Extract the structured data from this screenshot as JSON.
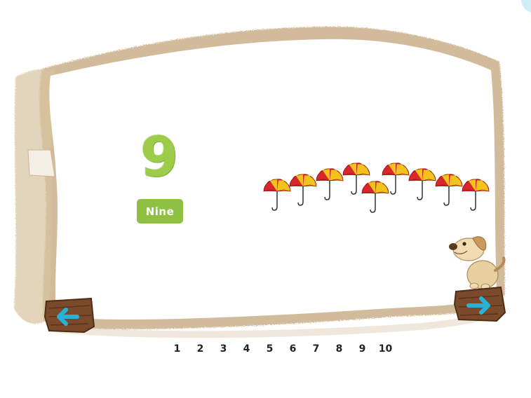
{
  "lesson": {
    "digit": "9",
    "word": "Nine",
    "object_count": 9,
    "object_icon": "umbrella-icon"
  },
  "number_nav": [
    "1",
    "2",
    "3",
    "4",
    "5",
    "6",
    "7",
    "8",
    "9",
    "10"
  ],
  "colors": {
    "digit": "#9ccc4a",
    "badge": "#8fc043",
    "umbrella_red": "#d8262a",
    "umbrella_yellow": "#f4c21c",
    "wood": "#7a4a2a",
    "arrow": "#27b3d8",
    "parchment_edge": "#c8b08a"
  },
  "controls": {
    "prev_icon": "arrow-left-icon",
    "next_icon": "arrow-right-icon",
    "mascot": "dog-mascot"
  }
}
